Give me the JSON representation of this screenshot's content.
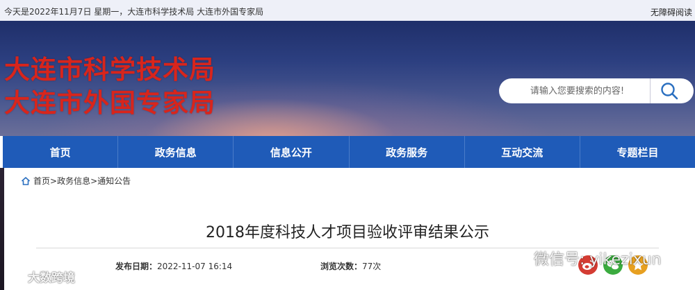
{
  "topbar": {
    "date_text": "今天是2022年11月7日 星期一，大连市科学技术局 大连市外国专家局",
    "accessibility": "无障碍阅读"
  },
  "banner": {
    "title_line1": "大连市科学技术局",
    "title_line2": "大连市外国专家局"
  },
  "search": {
    "placeholder": "请输入您要搜索的内容!"
  },
  "nav": [
    "首页",
    "政务信息",
    "信息公开",
    "政务服务",
    "互动交流",
    "专题栏目"
  ],
  "breadcrumb": [
    "首页",
    "政务信息",
    "通知公告"
  ],
  "breadcrumb_sep": ">",
  "article": {
    "title": "2018年度科技人才项目验收评审结果公示",
    "publish_label": "发布日期：",
    "publish_value": "2022-11-07  16:14",
    "views_label": "浏览次数：",
    "views_value": "77次"
  },
  "watermarks": {
    "wechat": "微信号: yikezixun",
    "dashuju": "大数跨境"
  },
  "colors": {
    "nav_bg": "#1f5bb8",
    "title_red": "#d8251c",
    "weibo": "#d43c33",
    "wechat": "#3bab3f",
    "qzone": "#e7a021"
  }
}
